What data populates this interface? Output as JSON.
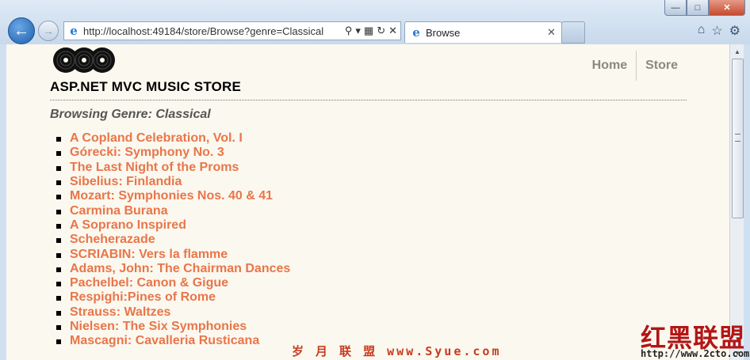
{
  "browser": {
    "url": "http://localhost:49184/store/Browse?genre=Classical",
    "tab_title": "Browse"
  },
  "site": {
    "title": "ASP.NET MVC MUSIC STORE",
    "nav": [
      "Home",
      "Store"
    ]
  },
  "page": {
    "heading": "Browsing Genre: Classical",
    "albums": [
      "A Copland Celebration, Vol. I",
      "Górecki: Symphony No. 3",
      "The Last Night of the Proms",
      "Sibelius: Finlandia",
      "Mozart: Symphonies Nos. 40 & 41",
      "Carmina Burana",
      "A Soprano Inspired",
      "Scheherazade",
      "SCRIABIN: Vers la flamme",
      "Adams, John: The Chairman Dances",
      "Pachelbel: Canon & Gigue",
      "Respighi:Pines of Rome",
      "Strauss: Waltzes",
      "Nielsen: The Six Symphonies",
      "Mascagni: Cavalleria Rusticana"
    ]
  },
  "watermarks": {
    "center": "岁 月 联 盟  www.Syue.com",
    "corner_logo": "红黑联盟",
    "corner_url": "http://www.2cto.com"
  },
  "colors": {
    "link": "#e8764a",
    "page_bg": "#fbf8ef",
    "nav_text": "#8a8a7e"
  }
}
